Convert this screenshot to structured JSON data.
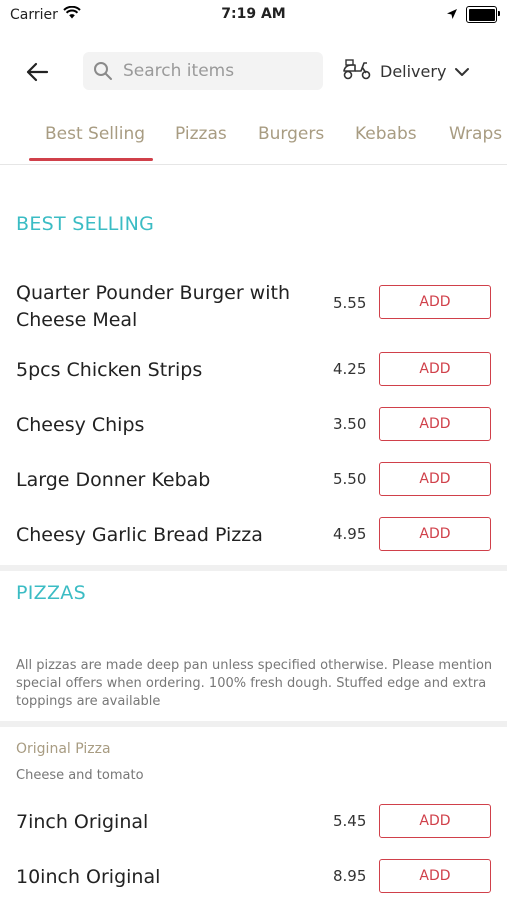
{
  "status": {
    "carrier": "Carrier",
    "time": "7:19 AM"
  },
  "header": {
    "search_placeholder": "Search items",
    "delivery_label": "Delivery"
  },
  "tabs": [
    {
      "label": "Best Selling",
      "active": true
    },
    {
      "label": "Pizzas"
    },
    {
      "label": "Burgers"
    },
    {
      "label": "Kebabs"
    },
    {
      "label": "Wraps"
    }
  ],
  "best_selling": {
    "title": "BEST SELLING",
    "items": [
      {
        "name": "Quarter Pounder Burger with Cheese Meal",
        "price": "5.55",
        "button": "ADD"
      },
      {
        "name": "5pcs Chicken Strips",
        "price": "4.25",
        "button": "ADD"
      },
      {
        "name": "Cheesy Chips",
        "price": "3.50",
        "button": "ADD"
      },
      {
        "name": "Large Donner Kebab",
        "price": "5.50",
        "button": "ADD"
      },
      {
        "name": "Cheesy Garlic Bread Pizza",
        "price": "4.95",
        "button": "ADD"
      }
    ]
  },
  "pizzas": {
    "title": "PIZZAS",
    "note": "All pizzas are made deep pan unless specified otherwise. Please mention special offers when ordering. 100% fresh dough. Stuffed edge and extra toppings are available",
    "subcategory": "Original Pizza",
    "subcategory_desc": "Cheese and tomato",
    "items": [
      {
        "name": "7inch Original",
        "price": "5.45",
        "button": "ADD"
      },
      {
        "name": "10inch Original",
        "price": "8.95",
        "button": "ADD"
      }
    ]
  },
  "colors": {
    "accent": "#d0404a",
    "section_title": "#3bbcc4",
    "tab_text": "#a89c82"
  }
}
